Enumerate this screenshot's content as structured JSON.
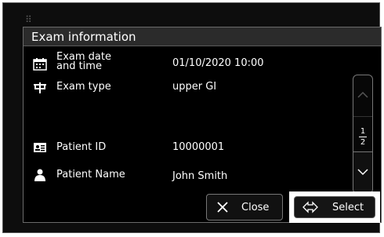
{
  "dialog": {
    "title": "Exam information",
    "rows": [
      {
        "icon": "calendar-icon",
        "label_line1": "Exam date",
        "label_line2": "and time",
        "value": "01/10/2020 10:00"
      },
      {
        "icon": "exam-type-icon",
        "label": "Exam type",
        "value": "upper GI"
      },
      {
        "icon": "id-card-icon",
        "label": "Patient ID",
        "value": "10000001"
      },
      {
        "icon": "person-icon",
        "label": "Patient Name",
        "value": "John Smith"
      }
    ],
    "pager": {
      "current": "1",
      "total": "2"
    },
    "buttons": {
      "close_label": "Close",
      "select_label": "Select"
    }
  },
  "colors": {
    "background": "#000000",
    "text": "#ffffff",
    "border": "#777777",
    "highlight": "#ffffff"
  }
}
